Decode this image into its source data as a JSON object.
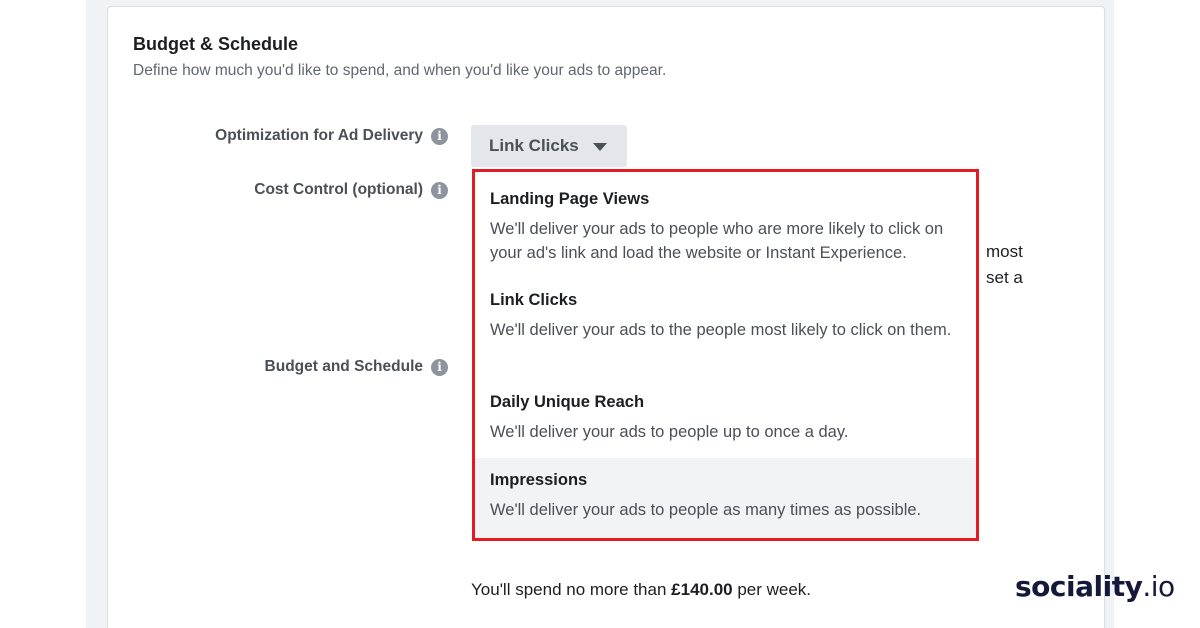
{
  "section": {
    "title": "Budget & Schedule",
    "subtitle": "Define how much you'd like to spend, and when you'd like your ads to appear."
  },
  "fields": {
    "optimization_label": "Optimization for Ad Delivery",
    "cost_control_label": "Cost Control (optional)",
    "budget_label": "Budget and Schedule",
    "info_icon_glyph": "i"
  },
  "dropdown": {
    "selected_value": "Link Clicks"
  },
  "obscured_text": {
    "line1": "most",
    "line2": "set a"
  },
  "menu": {
    "border_color": "#e31b23",
    "items": [
      {
        "title": "Landing Page Views",
        "description": "We'll deliver your ads to people who are more likely to click on your ad's link and load the website or Instant Experience."
      },
      {
        "title": "Link Clicks",
        "description": "We'll deliver your ads to the people most likely to click on them."
      },
      {
        "title": "Daily Unique Reach",
        "description": "We'll deliver your ads to people up to once a day."
      },
      {
        "title": "Impressions",
        "description": "We'll deliver your ads to people as many times as possible."
      }
    ]
  },
  "spend": {
    "prefix": "You'll spend no more than ",
    "amount": "£140.00",
    "suffix": " per week."
  },
  "logo": {
    "main": "sociality",
    "tld": ".io"
  }
}
